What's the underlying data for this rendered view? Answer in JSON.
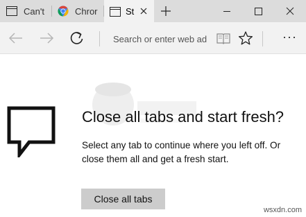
{
  "tabs": [
    {
      "label": "Can't",
      "icon": "page-icon",
      "active": false
    },
    {
      "label": "Chror",
      "icon": "chrome-icon",
      "active": false
    },
    {
      "label": "St",
      "icon": "page-icon",
      "active": true
    }
  ],
  "new_tab_label": "+",
  "window_controls": {
    "minimize": "minimize-icon",
    "maximize": "maximize-icon",
    "close": "close-icon"
  },
  "toolbar": {
    "back_icon": "back-arrow-icon",
    "forward_icon": "forward-arrow-icon",
    "refresh_icon": "refresh-icon",
    "address_placeholder": "Search or enter web ad",
    "reading_view_icon": "book-icon",
    "favorite_icon": "star-icon",
    "more_label": "···"
  },
  "page": {
    "heading": "Close all tabs and start fresh?",
    "description": "Select any tab to continue where you left off. Or close them all and get a fresh start.",
    "button_label": "Close all tabs"
  },
  "site_watermark": "wsxdn.com",
  "colors": {
    "tabstrip_bg": "#dcdcdc",
    "active_tab_bg": "#f2f2f2",
    "button_bg": "#cccccc",
    "chrome_red": "#db4437",
    "chrome_green": "#0f9d58",
    "chrome_yellow": "#f4b400",
    "chrome_blue": "#4285f4"
  }
}
